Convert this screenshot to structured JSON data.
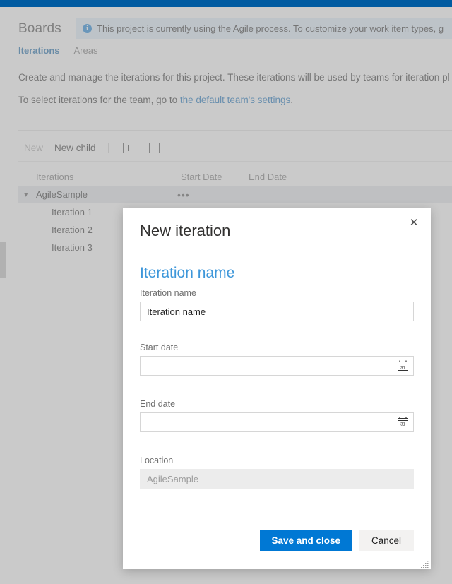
{
  "app": {
    "top_bar_color": "#005ba1",
    "header_title": "Boards"
  },
  "banner": {
    "icon": "info-icon",
    "text": "This project is currently using the Agile process. To customize your work item types, g",
    "link_text": "g"
  },
  "tabs": [
    {
      "label": "Iterations",
      "active": true
    },
    {
      "label": "Areas",
      "active": false
    }
  ],
  "description": {
    "line1": "Create and manage the iterations for this project. These iterations will be used by teams for iteration pl",
    "line2_prefix": "To select iterations for the team, go to ",
    "line2_link": "the default team's settings",
    "line2_suffix": "."
  },
  "toolbar": {
    "new_label": "New",
    "new_child_label": "New child",
    "expand_icon": "expand-all-icon",
    "collapse_icon": "collapse-all-icon"
  },
  "table": {
    "headers": {
      "iterations": "Iterations",
      "start_date": "Start Date",
      "end_date": "End Date"
    },
    "rows": [
      {
        "name": "AgileSample",
        "level": 0,
        "selected": true,
        "expanded": true,
        "start_date": "",
        "end_date": "",
        "context_menu": "•••"
      },
      {
        "name": "Iteration 1",
        "level": 1,
        "selected": false,
        "start_date": "",
        "end_date": ""
      },
      {
        "name": "Iteration 2",
        "level": 1,
        "selected": false,
        "start_date": "",
        "end_date": ""
      },
      {
        "name": "Iteration 3",
        "level": 1,
        "selected": false,
        "start_date": "",
        "end_date": ""
      }
    ]
  },
  "dialog": {
    "title": "New iteration",
    "close_icon": "close-icon",
    "section_heading": "Iteration name",
    "fields": {
      "name": {
        "label": "Iteration name",
        "value": "",
        "placeholder": "Iteration name"
      },
      "start_date": {
        "label": "Start date",
        "value": "",
        "placeholder": "",
        "icon": "calendar-icon"
      },
      "end_date": {
        "label": "End date",
        "value": "",
        "placeholder": "",
        "icon": "calendar-icon"
      },
      "location": {
        "label": "Location",
        "value": "",
        "placeholder": "AgileSample",
        "readonly": true
      }
    },
    "buttons": {
      "save": "Save and close",
      "cancel": "Cancel"
    },
    "accent_color": "#0078d4",
    "heading_color": "#3e97da"
  }
}
